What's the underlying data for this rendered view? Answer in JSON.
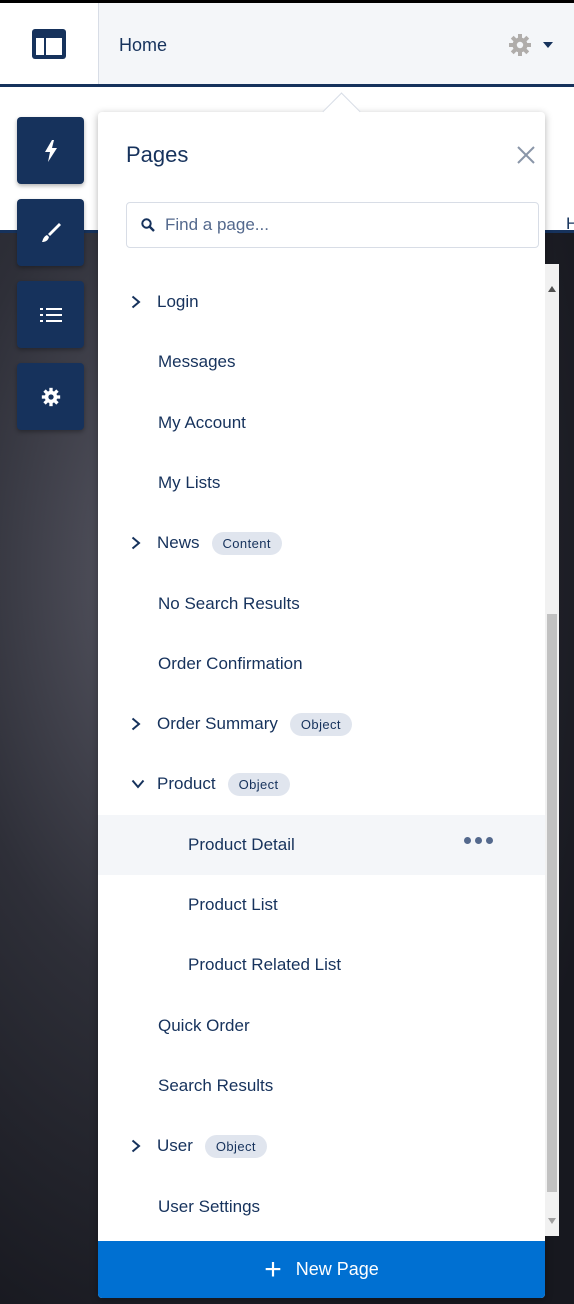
{
  "header": {
    "title": "Home",
    "logo_icon": "layout-icon",
    "settings_icon": "gear-icon"
  },
  "toolbar": {
    "tools": [
      {
        "name": "lightning-icon"
      },
      {
        "name": "brush-icon"
      },
      {
        "name": "list-icon"
      },
      {
        "name": "gear-icon"
      }
    ]
  },
  "panel": {
    "title": "Pages",
    "search_placeholder": "Find a page...",
    "items": [
      {
        "label": "Login",
        "expandable": true,
        "expanded": false,
        "badge": ""
      },
      {
        "label": "Messages",
        "expandable": false,
        "badge": ""
      },
      {
        "label": "My Account",
        "expandable": false,
        "badge": ""
      },
      {
        "label": "My Lists",
        "expandable": false,
        "badge": ""
      },
      {
        "label": "News",
        "expandable": true,
        "expanded": false,
        "badge": "Content"
      },
      {
        "label": "No Search Results",
        "expandable": false,
        "badge": ""
      },
      {
        "label": "Order Confirmation",
        "expandable": false,
        "badge": ""
      },
      {
        "label": "Order Summary",
        "expandable": true,
        "expanded": false,
        "badge": "Object"
      },
      {
        "label": "Product",
        "expandable": true,
        "expanded": true,
        "badge": "Object"
      },
      {
        "label": "Product Detail",
        "child": true,
        "selected": true,
        "badge": ""
      },
      {
        "label": "Product List",
        "child": true,
        "badge": ""
      },
      {
        "label": "Product Related List",
        "child": true,
        "badge": ""
      },
      {
        "label": "Quick Order",
        "expandable": false,
        "badge": ""
      },
      {
        "label": "Search Results",
        "expandable": false,
        "badge": ""
      },
      {
        "label": "User",
        "expandable": true,
        "expanded": false,
        "badge": "Object"
      },
      {
        "label": "User Settings",
        "expandable": false,
        "badge": ""
      }
    ],
    "new_page_label": "New Page"
  },
  "colors": {
    "navy": "#16325c",
    "brand_blue": "#0070d2",
    "badge_bg": "#e0e5ee",
    "selected_bg": "#f4f6f9"
  }
}
